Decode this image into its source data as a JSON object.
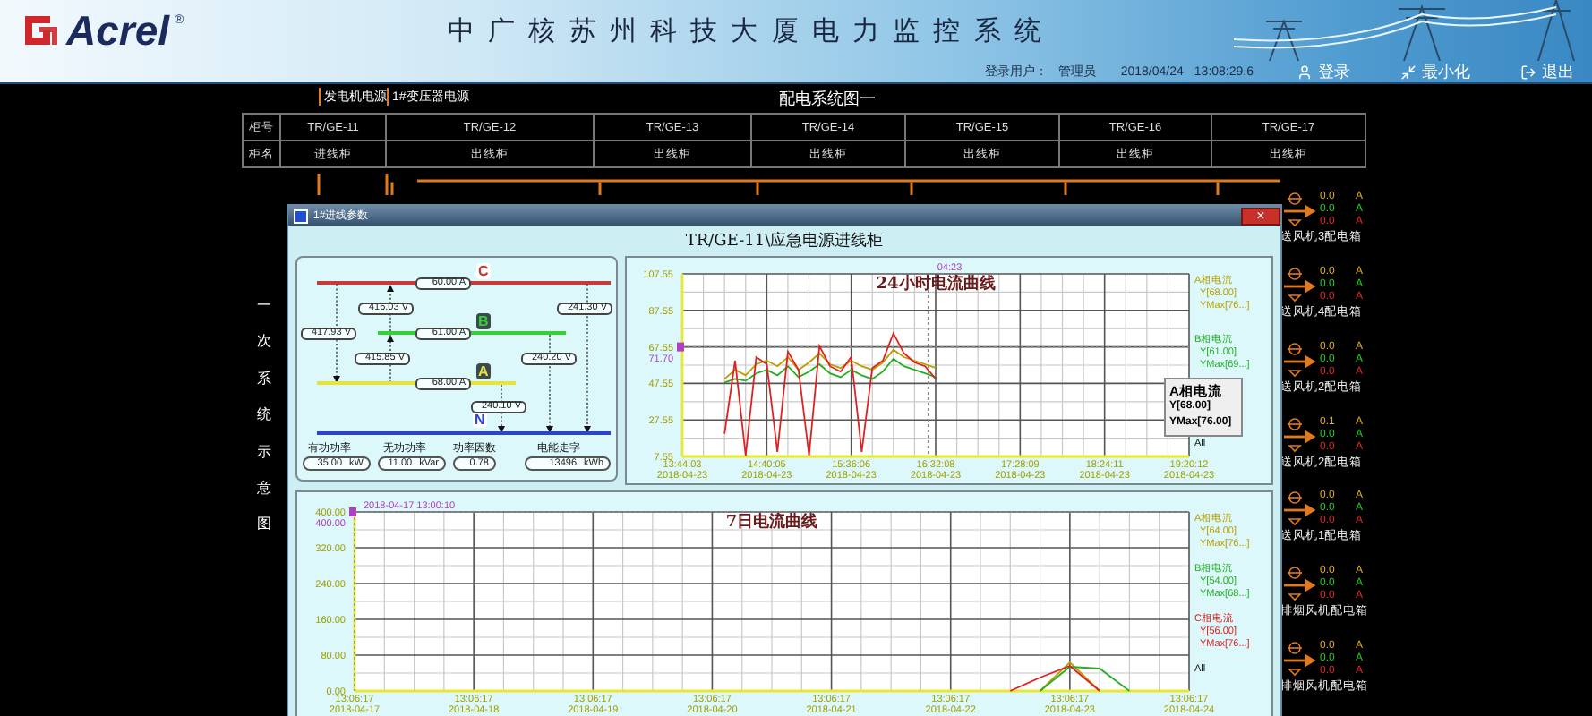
{
  "header": {
    "logo": "Acrel",
    "trademark": "®",
    "title": "中广核苏州科技大厦电力监控系统",
    "user_label": "登录用户：",
    "user": "管理员",
    "date": "2018/04/24",
    "time": "13:08:29.6",
    "buttons": [
      {
        "kind": "login",
        "label": "登录"
      },
      {
        "kind": "minimize",
        "label": "最小化"
      },
      {
        "kind": "exit",
        "label": "退出"
      }
    ]
  },
  "diagram": {
    "sources": [
      "发电机电源",
      "1#变压器电源"
    ],
    "title": "配电系统图一",
    "row_headers": [
      "柜号",
      "柜名"
    ],
    "cabinets": [
      {
        "id": "TR/GE-11",
        "name": "进线柜"
      },
      {
        "id": "TR/GE-12",
        "name": "出线柜"
      },
      {
        "id": "TR/GE-13",
        "name": "出线柜"
      },
      {
        "id": "TR/GE-14",
        "name": "出线柜"
      },
      {
        "id": "TR/GE-15",
        "name": "出线柜"
      },
      {
        "id": "TR/GE-16",
        "name": "出线柜"
      },
      {
        "id": "TR/GE-17",
        "name": "出线柜"
      }
    ],
    "side_label": "一次系统示意图",
    "feeders": [
      {
        "name": "送风机3配电箱",
        "readings": [
          {
            "value": "0.0",
            "unit": "A"
          },
          {
            "value": "0.0",
            "unit": "A"
          },
          {
            "value": "0.0",
            "unit": "A"
          }
        ]
      },
      {
        "name": "送风机4配电箱",
        "readings": [
          {
            "value": "0.0",
            "unit": "A"
          },
          {
            "value": "0.0",
            "unit": "A"
          },
          {
            "value": "0.0",
            "unit": "A"
          }
        ]
      },
      {
        "name": "送风机2配电箱",
        "readings": [
          {
            "value": "0.0",
            "unit": "A"
          },
          {
            "value": "0.0",
            "unit": "A"
          },
          {
            "value": "0.0",
            "unit": "A"
          }
        ]
      },
      {
        "name": "送风机2配电箱",
        "readings": [
          {
            "value": "0.1",
            "unit": "A"
          },
          {
            "value": "0.0",
            "unit": "A"
          },
          {
            "value": "0.0",
            "unit": "A"
          }
        ]
      },
      {
        "name": "送风机1配电箱",
        "readings": [
          {
            "value": "0.0",
            "unit": "A"
          },
          {
            "value": "0.0",
            "unit": "A"
          },
          {
            "value": "0.0",
            "unit": "A"
          }
        ]
      },
      {
        "name": "排烟风机配电箱",
        "readings": [
          {
            "value": "0.0",
            "unit": "A"
          },
          {
            "value": "0.0",
            "unit": "A"
          },
          {
            "value": "0.0",
            "unit": "A"
          }
        ]
      },
      {
        "name": "排烟风机配电箱",
        "readings": [
          {
            "value": "0.0",
            "unit": "A"
          },
          {
            "value": "0.0",
            "unit": "A"
          },
          {
            "value": "0.0",
            "unit": "A"
          }
        ]
      }
    ]
  },
  "dialog": {
    "title": "1#进线参数",
    "close": "×",
    "heading": "TR/GE-11\\应急电源进线柜",
    "phasor": {
      "lines": [
        {
          "phase": "C",
          "color": "#c83a3a",
          "current": "60.00 A"
        },
        {
          "phase": "B",
          "color": "#35d035",
          "current": "61.00 A"
        },
        {
          "phase": "A",
          "color": "#e4e43c",
          "current": "68.00 A"
        },
        {
          "phase": "N",
          "color": "#2a44d0"
        }
      ],
      "line_voltages": [
        "416.03 V",
        "415.85 V",
        "417.93 V"
      ],
      "phase_voltages": [
        "241.30 V",
        "240.20 V",
        "240.10 V"
      ],
      "metrics": [
        {
          "label": "有功功率",
          "value": "35.00",
          "unit": "kW"
        },
        {
          "label": "无功功率",
          "value": "11.00",
          "unit": "kVar"
        },
        {
          "label": "功率因数",
          "value": "0.78"
        },
        {
          "label": "电能走字",
          "value": "13496",
          "unit": "kWh"
        }
      ]
    },
    "chart_24h": {
      "legend": [
        {
          "y": "Y[68.00]",
          "ymax": "YMax[76...]"
        },
        {
          "y": "Y[61.00]",
          "ymax": "YMax[69...]"
        }
      ],
      "all": "All",
      "tooltip": [
        "A相电流",
        "Y[68.00]",
        "YMax[76.00]"
      ],
      "cursor": {
        "time": "04:23",
        "value": "71.70"
      },
      "chart_data": {
        "type": "line",
        "title": "24小时电流曲线",
        "grid": true,
        "categories": [
          "13:44:03\n2018-04-23",
          null,
          null,
          null,
          null,
          null,
          null,
          null,
          "14:40:05\n2018-04-23",
          null,
          null,
          null,
          null,
          null,
          null,
          null,
          "15:36:06\n2018-04-23",
          null,
          null,
          null,
          null,
          null,
          null,
          null,
          "16:32:08\n2018-04-23",
          null,
          null,
          null,
          null,
          null,
          null,
          null,
          "17:28:09\n2018-04-23",
          null,
          null,
          null,
          null,
          null,
          null,
          null,
          "18:24:11\n2018-04-23",
          null,
          null,
          null,
          null,
          null,
          null,
          null,
          "19:20:12\n2018-04-23"
        ],
        "ylim": [
          7.55,
          107.55
        ],
        "yticks": [
          7.55,
          27.55,
          47.55,
          67.55,
          87.55,
          107.55
        ],
        "series": [
          {
            "name": "A相电流",
            "color": "#b8a000",
            "values": [
              null,
              null,
              null,
              null,
              50,
              55,
              52,
              58,
              60,
              57,
              62,
              55,
              59,
              64,
              58,
              56,
              60,
              57,
              55,
              59,
              66,
              62,
              60,
              58,
              56,
              null,
              null,
              null,
              null,
              null,
              null,
              null,
              null,
              null,
              null,
              null,
              null,
              null,
              null,
              null,
              null,
              null,
              null,
              null,
              null,
              null,
              null,
              null,
              null
            ]
          },
          {
            "name": "B相电流",
            "color": "#22b022",
            "values": [
              null,
              null,
              null,
              null,
              48,
              50,
              49,
              53,
              55,
              52,
              57,
              51,
              54,
              58,
              53,
              51,
              55,
              52,
              50,
              54,
              61,
              57,
              55,
              53,
              51,
              null,
              null,
              null,
              null,
              null,
              null,
              null,
              null,
              null,
              null,
              null,
              null,
              null,
              null,
              null,
              null,
              null,
              null,
              null,
              null,
              null,
              null,
              null,
              null
            ]
          },
          {
            "color": "#e02020",
            "values": [
              null,
              null,
              null,
              null,
              20,
              60,
              8,
              62,
              58,
              10,
              65,
              55,
              8,
              68,
              57,
              54,
              62,
              10,
              56,
              60,
              75,
              64,
              59,
              57,
              50,
              null,
              null,
              null,
              null,
              null,
              null,
              null,
              null,
              null,
              null,
              null,
              null,
              null,
              null,
              null,
              null,
              null,
              null,
              null,
              null,
              null,
              null,
              null,
              null
            ]
          }
        ]
      }
    },
    "chart_7d": {
      "legend": [
        {
          "y": "Y[64.00]",
          "ymax": "YMax[76...]"
        },
        {
          "y": "Y[54.00]",
          "ymax": "YMax[68...]"
        },
        {
          "y": "Y[56.00]",
          "ymax": "YMax[76...]"
        }
      ],
      "all": "All",
      "cursor": {
        "time": "2018-04-17 13:00:10",
        "value": "400.00"
      },
      "chart_data": {
        "type": "line",
        "title": "7日电流曲线",
        "grid": true,
        "categories": [
          "13:06:17\n2018-04-17",
          null,
          null,
          null,
          "13:06:17\n2018-04-18",
          null,
          null,
          null,
          "13:06:17\n2018-04-19",
          null,
          null,
          null,
          "13:06:17\n2018-04-20",
          null,
          null,
          null,
          "13:06:17\n2018-04-21",
          null,
          null,
          null,
          "13:06:17\n2018-04-22",
          null,
          null,
          null,
          "13:06:17\n2018-04-23",
          null,
          null,
          null,
          "13:06:17\n2018-04-24"
        ],
        "ylim": [
          0,
          400
        ],
        "yticks": [
          {
            "value": 0,
            "label": "0.00"
          },
          {
            "value": 80,
            "label": "80.00"
          },
          {
            "value": 160,
            "label": "160.00"
          },
          {
            "value": 240,
            "label": "240.00"
          },
          {
            "value": 320,
            "label": "320.00"
          },
          {
            "value": 400,
            "label": "400.00"
          }
        ],
        "series": [
          {
            "name": "A相电流",
            "color": "#b8a000",
            "values": [
              null,
              null,
              null,
              null,
              null,
              null,
              null,
              null,
              null,
              null,
              null,
              null,
              null,
              null,
              null,
              null,
              null,
              null,
              null,
              null,
              null,
              null,
              null,
              0,
              64,
              0,
              null,
              null,
              null
            ]
          },
          {
            "name": "B相电流",
            "color": "#22b022",
            "values": [
              null,
              null,
              null,
              null,
              null,
              null,
              null,
              null,
              null,
              null,
              null,
              null,
              null,
              null,
              null,
              null,
              null,
              null,
              null,
              null,
              null,
              null,
              null,
              0,
              54,
              50,
              0,
              null,
              null
            ]
          },
          {
            "name": "C相电流",
            "color": "#e02020",
            "values": [
              null,
              null,
              null,
              null,
              null,
              null,
              null,
              null,
              null,
              null,
              null,
              null,
              null,
              null,
              null,
              null,
              null,
              null,
              null,
              null,
              null,
              null,
              0,
              30,
              56,
              0,
              null,
              null,
              null
            ]
          }
        ]
      }
    }
  }
}
